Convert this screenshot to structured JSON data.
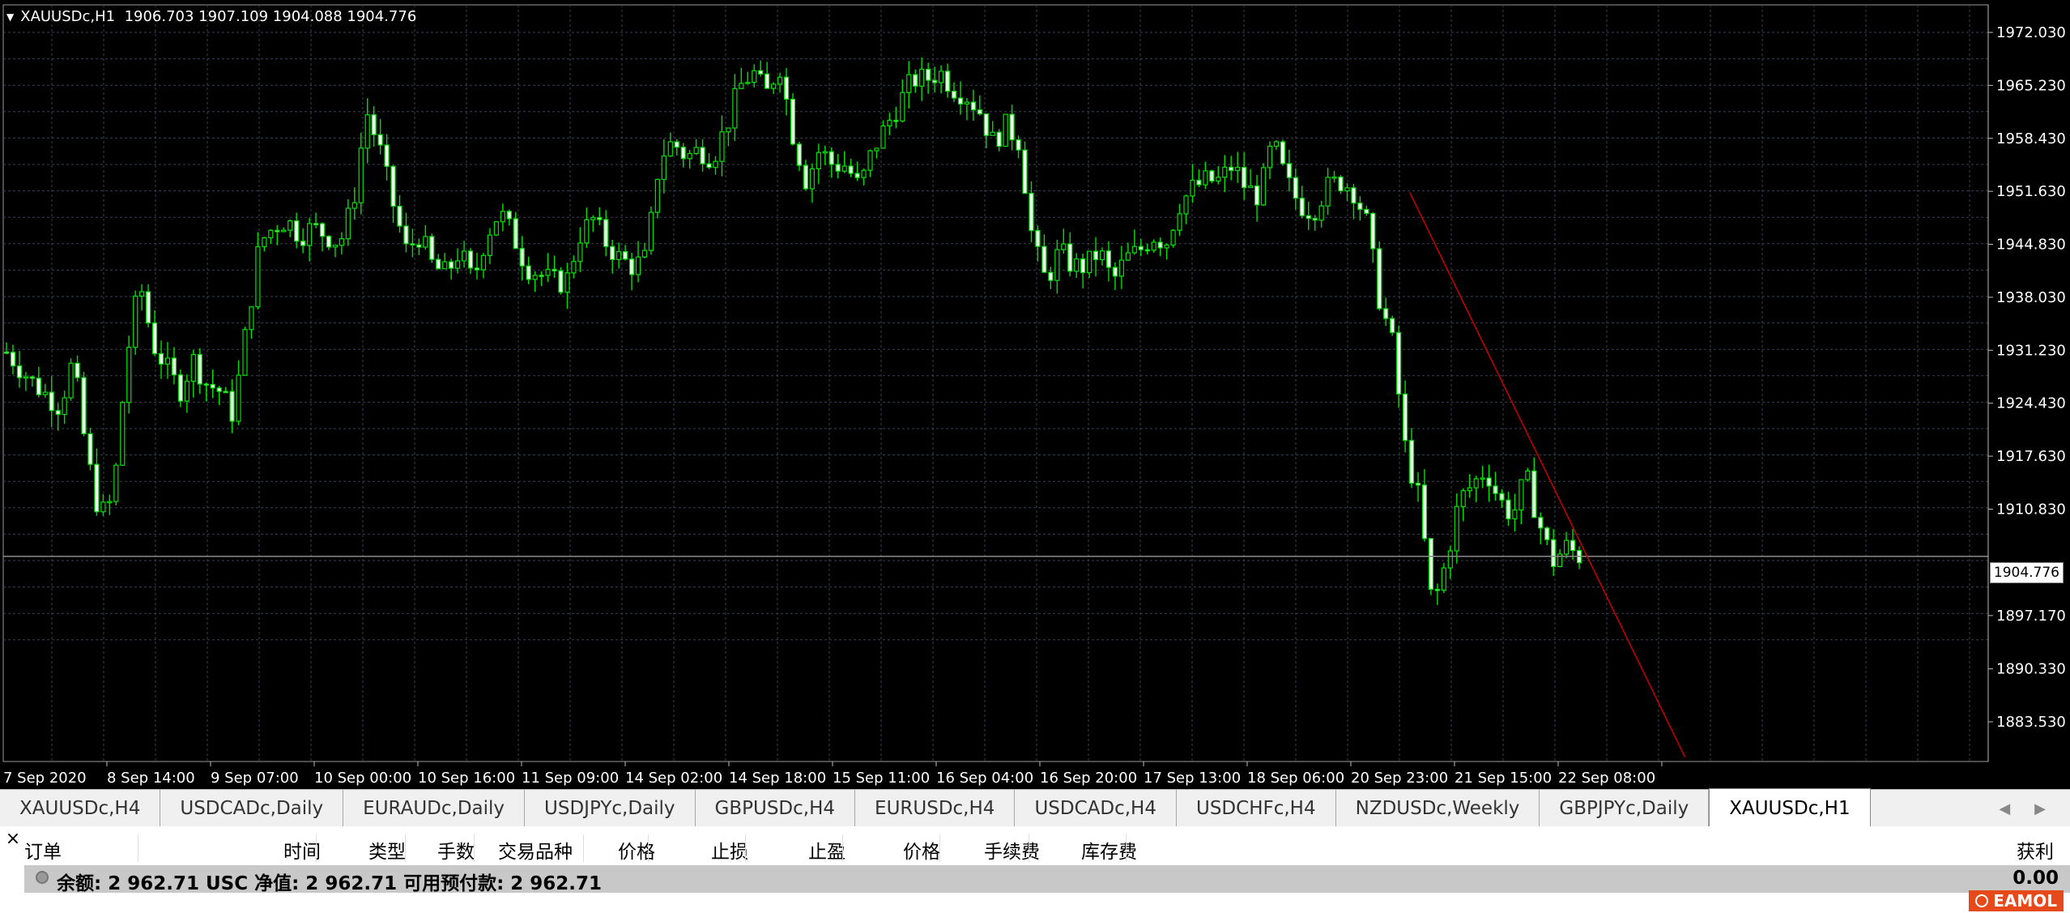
{
  "chart": {
    "symbol_title": "XAUUSDc,H1",
    "ohlc": "1906.703 1907.109 1904.088 1904.776",
    "current_price": "1904.776",
    "colors": {
      "background": "#000000",
      "grid": "#3a4250",
      "candle": "#00e000",
      "trendline": "#c00000",
      "current_line": "#8a8a8a",
      "axis_text": "#ffffff"
    }
  },
  "chart_data": {
    "type": "candlestick",
    "title": "XAUUSDc,H1",
    "y_ticks": [
      1972.03,
      1965.23,
      1958.43,
      1951.63,
      1944.83,
      1938.03,
      1931.23,
      1924.43,
      1917.63,
      1910.83,
      1897.17,
      1890.33,
      1883.53
    ],
    "y_tick_labels": [
      "1972.030",
      "1965.230",
      "1958.430",
      "1951.630",
      "1944.830",
      "1938.030",
      "1931.230",
      "1924.430",
      "1917.630",
      "1910.830",
      "1897.170",
      "1890.330",
      "1883.530"
    ],
    "ylim": [
      1878.5,
      1977.7
    ],
    "x_labels": [
      "7 Sep 2020",
      "8 Sep 14:00",
      "9 Sep 07:00",
      "10 Sep 00:00",
      "10 Sep 16:00",
      "11 Sep 09:00",
      "14 Sep 02:00",
      "14 Sep 18:00",
      "15 Sep 11:00",
      "16 Sep 04:00",
      "16 Sep 20:00",
      "17 Sep 13:00",
      "18 Sep 06:00",
      "20 Sep 23:00",
      "21 Sep 15:00",
      "22 Sep 08:00"
    ],
    "close_path": [
      [
        0,
        1931.0
      ],
      [
        2,
        1927.0
      ],
      [
        4,
        1924.0
      ],
      [
        5,
        1930.0
      ],
      [
        6,
        1918.0
      ],
      [
        7,
        1910.0
      ],
      [
        8,
        1912.0
      ],
      [
        9,
        1930.0
      ],
      [
        10,
        1940.0
      ],
      [
        11,
        1932.0
      ],
      [
        12,
        1929.0
      ],
      [
        13,
        1926.0
      ],
      [
        14,
        1930.0
      ],
      [
        15,
        1927.0
      ],
      [
        16,
        1926.0
      ],
      [
        17,
        1923.0
      ],
      [
        18,
        1934.0
      ],
      [
        19,
        1945.0
      ],
      [
        20,
        1947.0
      ],
      [
        21,
        1948.0
      ],
      [
        22,
        1946.0
      ],
      [
        23,
        1947.0
      ],
      [
        24,
        1946.0
      ],
      [
        25,
        1945.0
      ],
      [
        26,
        1950.0
      ],
      [
        27,
        1962.0
      ],
      [
        28,
        1957.0
      ],
      [
        29,
        1950.0
      ],
      [
        30,
        1944.0
      ],
      [
        31,
        1946.0
      ],
      [
        32,
        1942.0
      ],
      [
        33,
        1941.0
      ],
      [
        34,
        1944.0
      ],
      [
        35,
        1940.0
      ],
      [
        36,
        1946.0
      ],
      [
        37,
        1949.0
      ],
      [
        38,
        1946.0
      ],
      [
        39,
        1942.0
      ],
      [
        40,
        1941.0
      ],
      [
        41,
        1940.0
      ],
      [
        42,
        1940.0
      ],
      [
        43,
        1946.0
      ],
      [
        44,
        1948.0
      ],
      [
        45,
        1945.0
      ],
      [
        46,
        1943.0
      ],
      [
        47,
        1942.0
      ],
      [
        48,
        1943.0
      ],
      [
        49,
        1956.0
      ],
      [
        50,
        1958.0
      ],
      [
        51,
        1956.0
      ],
      [
        52,
        1957.0
      ],
      [
        53,
        1956.0
      ],
      [
        54,
        1960.0
      ],
      [
        55,
        1965.0
      ],
      [
        56,
        1967.0
      ],
      [
        57,
        1964.0
      ],
      [
        58,
        1968.0
      ],
      [
        59,
        1959.0
      ],
      [
        60,
        1953.0
      ],
      [
        61,
        1957.0
      ],
      [
        62,
        1955.0
      ],
      [
        63,
        1955.0
      ],
      [
        64,
        1952.0
      ],
      [
        65,
        1957.0
      ],
      [
        66,
        1960.0
      ],
      [
        67,
        1963.0
      ],
      [
        68,
        1966.0
      ],
      [
        69,
        1966.0
      ],
      [
        70,
        1967.0
      ],
      [
        71,
        1965.0
      ],
      [
        72,
        1964.0
      ],
      [
        73,
        1962.0
      ],
      [
        74,
        1958.0
      ],
      [
        75,
        1960.0
      ],
      [
        76,
        1958.0
      ],
      [
        77,
        1945.0
      ],
      [
        78,
        1940.0
      ],
      [
        79,
        1944.0
      ],
      [
        80,
        1942.0
      ],
      [
        81,
        1942.0
      ],
      [
        82,
        1944.0
      ],
      [
        83,
        1940.0
      ],
      [
        84,
        1943.0
      ],
      [
        85,
        1944.0
      ],
      [
        86,
        1946.0
      ],
      [
        87,
        1945.0
      ],
      [
        88,
        1950.0
      ],
      [
        89,
        1952.0
      ],
      [
        90,
        1953.0
      ],
      [
        91,
        1953.0
      ],
      [
        92,
        1955.0
      ],
      [
        93,
        1952.0
      ],
      [
        94,
        1951.0
      ],
      [
        95,
        1958.0
      ],
      [
        96,
        1953.0
      ],
      [
        97,
        1950.0
      ],
      [
        98,
        1949.0
      ],
      [
        99,
        1952.0
      ],
      [
        100,
        1953.0
      ],
      [
        101,
        1952.0
      ],
      [
        102,
        1948.0
      ],
      [
        103,
        1938.0
      ],
      [
        104,
        1932.0
      ],
      [
        105,
        1918.0
      ],
      [
        106,
        1912.0
      ],
      [
        107,
        1898.0
      ],
      [
        108,
        1904.0
      ],
      [
        109,
        1912.0
      ],
      [
        110,
        1914.0
      ],
      [
        111,
        1916.0
      ],
      [
        112,
        1912.0
      ],
      [
        113,
        1910.0
      ],
      [
        114,
        1915.0
      ],
      [
        115,
        1909.0
      ],
      [
        116,
        1904.0
      ],
      [
        117,
        1906.0
      ],
      [
        118,
        1904.8
      ]
    ],
    "trendline": [
      [
        1951.5,
        0.681
      ],
      [
        1879.0,
        0.814
      ]
    ],
    "current_price": 1904.776
  },
  "tabs": [
    "XAUUSDc,H4",
    "USDCADc,Daily",
    "EURAUDc,Daily",
    "USDJPYc,Daily",
    "GBPUSDc,H4",
    "EURUSDc,H4",
    "USDCADc,H4",
    "USDCHFc,H4",
    "NZDUSDc,Weekly",
    "GBPJPYc,Daily",
    "XAUUSDc,H1"
  ],
  "active_tab_index": 10,
  "terminal": {
    "columns": [
      "订单",
      "时间",
      "类型",
      "手数",
      "交易品种",
      "价格",
      "止损",
      "止盈",
      "价格",
      "手续费",
      "库存费",
      "获利"
    ],
    "balance_text": "余额: 2 962.71 USC  净值: 2 962.71  可用预付款: 2 962.71",
    "profit": "0.00",
    "close_symbol": "×"
  },
  "watermark": "EAMOL"
}
